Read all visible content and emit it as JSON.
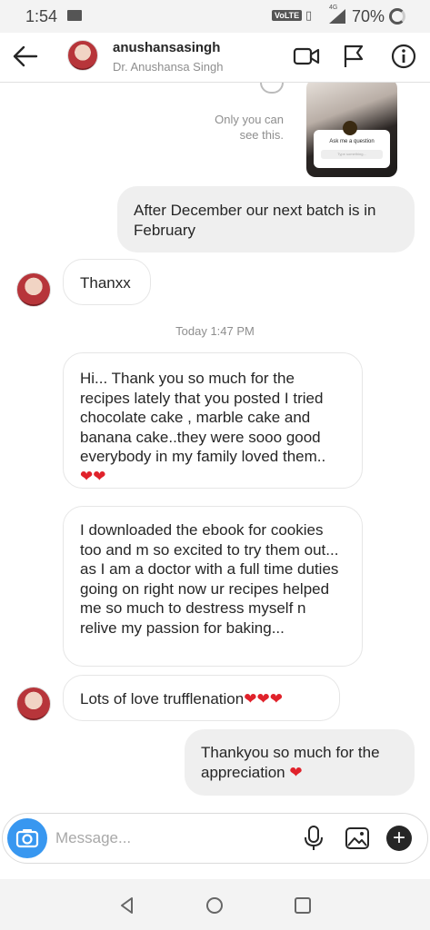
{
  "status_bar": {
    "time": "1:54",
    "volte": "VoLTE",
    "network": "4G",
    "battery": "70%"
  },
  "header": {
    "username": "anushansasingh",
    "full_name": "Dr. Anushansa Singh"
  },
  "story_reply": {
    "visibility_note": "Only you can see this.",
    "card_title": "Ask me a question",
    "card_field": "Type something..."
  },
  "messages": [
    {
      "from": "me",
      "text": "After December our next batch is in February"
    },
    {
      "from": "them",
      "text": "Thanxx"
    },
    {
      "from": "them",
      "text": "Hi... Thank you so much for the recipes lately that you posted I tried chocolate cake , marble cake and banana cake..they were sooo good everybody in my family loved them..",
      "hearts": "❤❤"
    },
    {
      "from": "them",
      "text": "I downloaded the ebook for cookies too and m so excited to try them out... as I am a doctor with a full time duties going on right now ur recipes helped me so much to destress myself n relive my passion for baking..."
    },
    {
      "from": "them",
      "text": "Lots of love trufflenation",
      "hearts": "❤❤❤"
    },
    {
      "from": "me",
      "text": "Thankyou so much for the appreciation",
      "hearts": "❤"
    }
  ],
  "timestamp": "Today 1:47 PM",
  "composer": {
    "placeholder": "Message..."
  },
  "colors": {
    "accent": "#3897f0",
    "heart": "#e0222b",
    "my_bubble": "#efefef"
  },
  "icons": [
    "back-arrow-icon",
    "video-call-icon",
    "flag-icon",
    "info-icon",
    "camera-icon",
    "microphone-icon",
    "gallery-icon",
    "plus-icon",
    "nav-back-icon",
    "nav-home-icon",
    "nav-recents-icon"
  ]
}
